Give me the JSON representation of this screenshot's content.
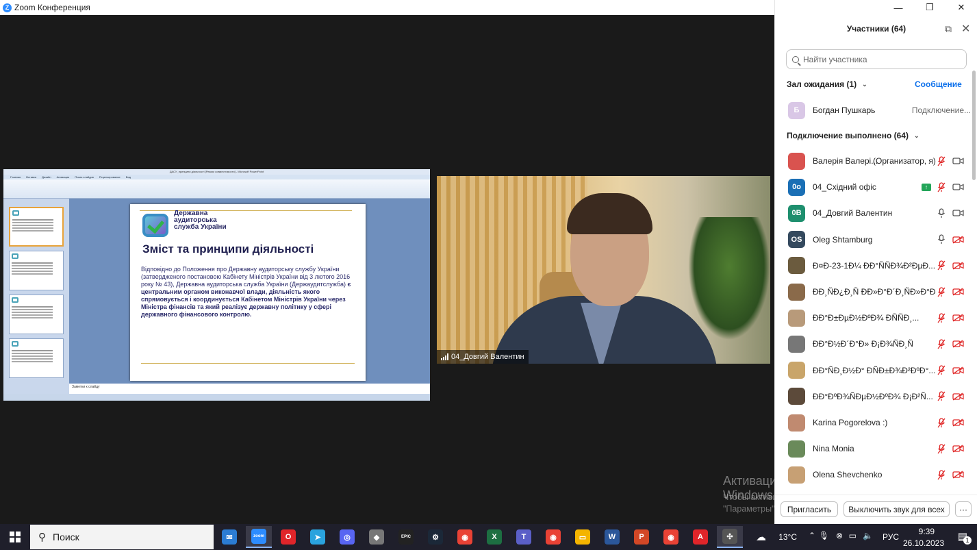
{
  "window": {
    "title": "Zoom Конференция",
    "controls": [
      "—",
      "❐",
      "✕"
    ]
  },
  "shared_screen": {
    "ppt_title": "ДАСУ_принципи діяльності [Режим совместимости] - Microsoft PowerPoint",
    "ppt_tabs": [
      "Главная",
      "Вставка",
      "Дизайн",
      "Анимация",
      "Показ слайдов",
      "Рецензирование",
      "Вид"
    ],
    "notes_placeholder": "Заметки к слайду",
    "slide": {
      "logo_text": "Державна аудиторська служба України",
      "heading": "Зміст та принципи діяльності",
      "body_plain": "Відповідно до Положення про Державну аудиторську службу України (затвердженого постановою Кабінету Міністрів України від 3 лютого 2016 року № 43), Державна аудиторська служба України (Держаудитслужба) ",
      "body_bold": "є центральним органом виконавчої влади, діяльність якого спрямовується і координується Кабінетом Міністрів України через Міністра фінансів та який реалізує державну політику у сфері державного фінансового контролю."
    }
  },
  "video": {
    "name": "04_Довгий Валентин"
  },
  "watermark": {
    "line1": "Активация Windows",
    "line2": "Чтобы активировать Windows, перейдите в раздел \"Параметры\"."
  },
  "panel": {
    "title": "Участники (64)",
    "search_placeholder": "Найти участника",
    "waiting": {
      "label": "Зал ожидания (1)",
      "action": "Сообщение",
      "person": {
        "initial": "Б",
        "name": "Богдан Пушкарь",
        "status": "Подключение..."
      }
    },
    "connected_label": "Подключение выполнено (64)",
    "participants": [
      {
        "initials": "",
        "name": "Валерія Валері...",
        "extra": "(Организатор, я)",
        "avatar_color": "#d9534f",
        "mic": "muted",
        "cam": "on"
      },
      {
        "initials": "0о",
        "name": "04_Східний офіс",
        "avatar_color": "#1a6fb5",
        "mic": "muted",
        "cam": "on",
        "sharing": true
      },
      {
        "initials": "0В",
        "name": "04_Довгий Валентин",
        "avatar_color": "#1e8f6e",
        "mic": "on",
        "cam": "on"
      },
      {
        "initials": "OS",
        "name": "Oleg Shtamburg",
        "avatar_color": "#34495e",
        "mic": "on",
        "cam": "off"
      },
      {
        "initials": "",
        "name": "Ð¤Ð-23-1Ð¼ ÐÐ°ÑÑÐ¾Ð²ÐµÐ...",
        "avatar_color": "#6b5b3e",
        "mic": "muted",
        "cam": "off"
      },
      {
        "initials": "",
        "name": "ÐÐ¸ÑÐ¿Ð¸Ñ ÐÐ»Ð°Ð´Ð¸ÑÐ»Ð°Ð²...",
        "avatar_color": "#8a6a4a",
        "mic": "muted",
        "cam": "off"
      },
      {
        "initials": "",
        "name": "ÐÐ°Ð±ÐµÐ½ÐºÐ¾ ÐÑÑÐ¸...",
        "avatar_color": "#b89a7a",
        "mic": "muted",
        "cam": "off"
      },
      {
        "initials": "",
        "name": "ÐÐ°Ð½Ð´Ð°Ð» Ð¡Ð¾ÑÐ¸Ñ",
        "avatar_color": "#777777",
        "mic": "muted",
        "cam": "off"
      },
      {
        "initials": "",
        "name": "ÐÐ°ÑÐ¸Ð½Ð° ÐÑÐ±Ð¾Ð²ÐºÐ°...",
        "avatar_color": "#c9a56a",
        "mic": "muted",
        "cam": "off"
      },
      {
        "initials": "",
        "name": "ÐÐ°ÐºÐ¾ÑÐµÐ½ÐºÐ¾ Ð¡Ð²Ñ...",
        "avatar_color": "#5c4a3a",
        "mic": "muted",
        "cam": "off"
      },
      {
        "initials": "",
        "name": "Karina Pogorelova :)",
        "avatar_color": "#c08a70",
        "mic": "muted",
        "cam": "off"
      },
      {
        "initials": "",
        "name": "Nina Monia",
        "avatar_color": "#6a8a5a",
        "mic": "muted",
        "cam": "off"
      },
      {
        "initials": "",
        "name": "Olena Shevchenko",
        "avatar_color": "#c7a074",
        "mic": "muted",
        "cam": "off"
      }
    ],
    "footer": {
      "invite": "Пригласить",
      "mute_all": "Выключить звук для всех",
      "more": "···"
    }
  },
  "taskbar": {
    "search_label": "Поиск",
    "apps": [
      "mail-icon",
      "zoom-icon",
      "opera-icon",
      "telegram-icon",
      "discord-icon",
      "roblox-icon",
      "epic-games-icon",
      "steam-icon",
      "chrome-icon",
      "excel-icon",
      "teams-icon",
      "chrome-2-icon",
      "explorer-icon",
      "word-icon",
      "powerpoint-icon",
      "chrome-3-icon",
      "acrobat-icon",
      "network-tool-icon"
    ],
    "weather_temp": "13°C",
    "lang": "РУС",
    "time": "9:39",
    "date": "26.10.2023",
    "notif_count": "1"
  }
}
